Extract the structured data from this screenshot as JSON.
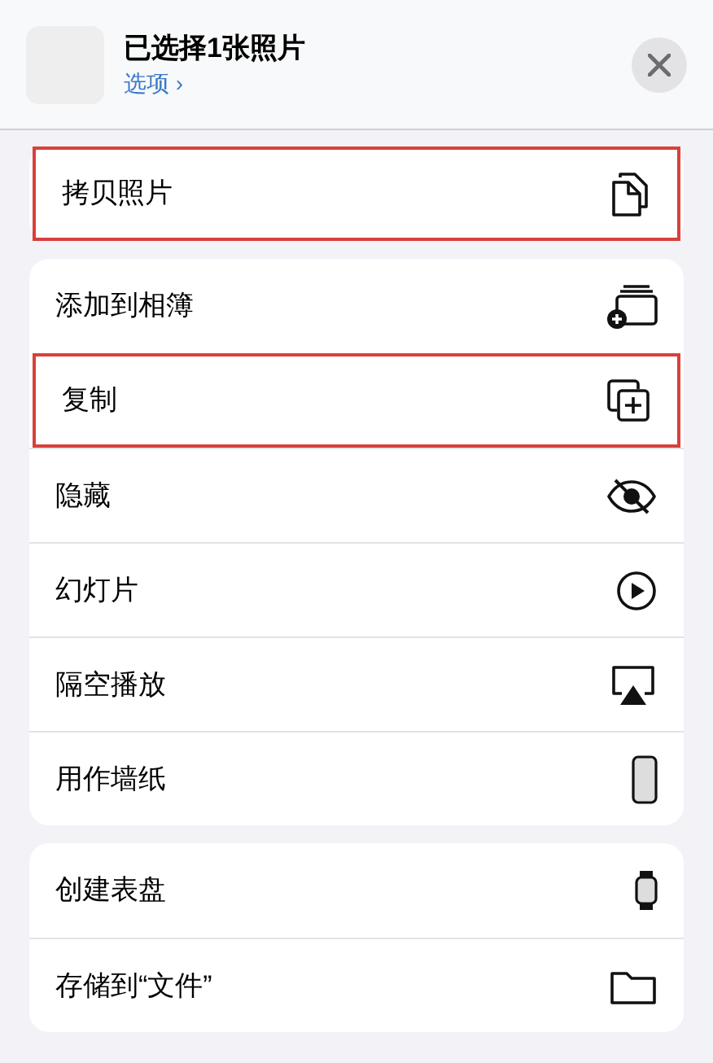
{
  "header": {
    "title": "已选择1张照片",
    "options_link": "选项 ›"
  },
  "groups": [
    {
      "items": [
        {
          "label": "拷贝照片",
          "kind": "copy",
          "highlighted": true
        }
      ]
    },
    {
      "items": [
        {
          "label": "添加到相簿",
          "kind": "album",
          "highlighted": false
        },
        {
          "label": "复制",
          "kind": "duplicate",
          "highlighted": true
        },
        {
          "label": "隐藏",
          "kind": "hide",
          "highlighted": false
        },
        {
          "label": "幻灯片",
          "kind": "play",
          "highlighted": false
        },
        {
          "label": "隔空播放",
          "kind": "airplay",
          "highlighted": false
        },
        {
          "label": "用作墙纸",
          "kind": "phone",
          "highlighted": false
        }
      ]
    },
    {
      "items": [
        {
          "label": "创建表盘",
          "kind": "watch",
          "highlighted": false
        },
        {
          "label": "存储到“文件”",
          "kind": "folder",
          "highlighted": false
        }
      ]
    }
  ]
}
